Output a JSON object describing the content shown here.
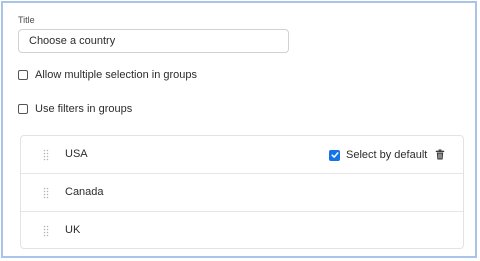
{
  "title_field": {
    "label": "Title",
    "value": "Choose a country"
  },
  "options": {
    "multiple_selection_label": "Allow multiple selection in groups",
    "use_filters_label": "Use filters in groups"
  },
  "items": [
    {
      "label": "USA",
      "select_by_default": true,
      "select_by_default_label": "Select by default"
    },
    {
      "label": "Canada"
    },
    {
      "label": "UK"
    }
  ],
  "colors": {
    "accent": "#1473e6",
    "frame_border": "#a9c4e8"
  },
  "icons": {
    "drag": "drag-handle-icon",
    "delete": "trash-icon",
    "check": "checkmark-icon"
  }
}
